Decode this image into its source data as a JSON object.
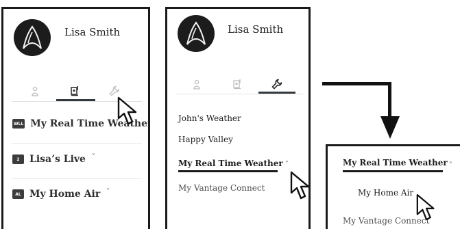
{
  "colors": {
    "panel_border": "#1a1a1a",
    "avatar_bg": "#1c1c1c",
    "tab_active": "#333a3f",
    "tab_inactive": "#c6c6c6",
    "badge_bg": "#3c3c3c"
  },
  "icons": {
    "avatar": "delta-emblem-icon",
    "tab_profile": "person-icon",
    "tab_devices": "device-icon",
    "tab_settings": "wrench-icon",
    "cursor": "mouse-pointer-icon",
    "flow": "bent-arrow-down-icon",
    "expand": "chevron-down-icon",
    "collapse": "chevron-up-icon"
  },
  "panel1": {
    "user_name": "Lisa Smith",
    "active_tab": "devices",
    "items": [
      {
        "badge": "WLL",
        "label": "My Real Time Weather",
        "has_chevron": false
      },
      {
        "badge": "2",
        "label": "Lisa’s Live",
        "has_chevron": true
      },
      {
        "badge": "AL",
        "label": "My Home Air",
        "has_chevron": true
      }
    ]
  },
  "panel2": {
    "user_name": "Lisa Smith",
    "active_tab": "settings",
    "items": [
      {
        "label": "John's Weather"
      },
      {
        "label": "Happy Valley"
      },
      {
        "label": "My Real Time Weather",
        "selected": true,
        "expand": "˅"
      },
      {
        "label": "My Vantage Connect"
      }
    ]
  },
  "panel3": {
    "header": {
      "label": "My Real Time Weather",
      "collapse": "˄"
    },
    "sub_item": "My Home Air",
    "next_item": "My Vantage Connect"
  }
}
